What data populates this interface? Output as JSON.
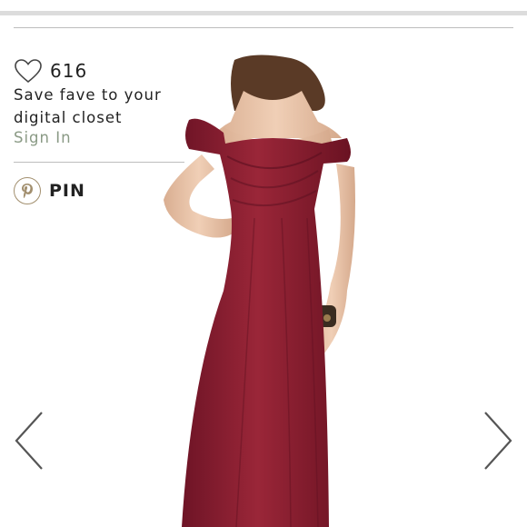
{
  "favorites": {
    "count": "616",
    "message": "Save fave to your digital closet",
    "sign_in_label": "Sign In",
    "icon": "heart-icon"
  },
  "pin": {
    "label": "PIN",
    "icon": "pinterest-icon"
  },
  "carousel": {
    "prev_icon": "chevron-left-icon",
    "next_icon": "chevron-right-icon"
  },
  "colors": {
    "dress": "#8e1f34",
    "sign_in": "#8a9a85",
    "pin_ring": "#a28f6e"
  }
}
